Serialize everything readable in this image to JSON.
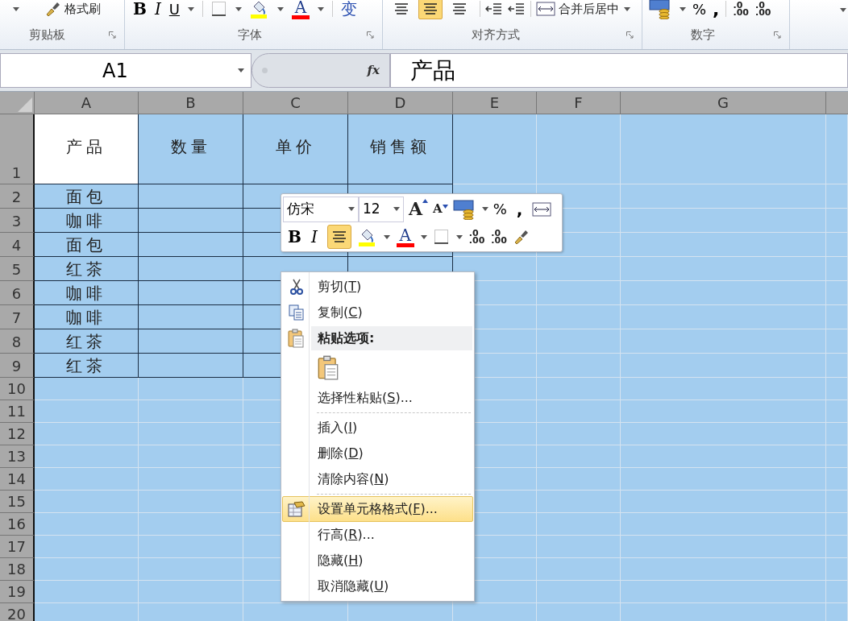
{
  "ribbon": {
    "clipboard": {
      "label": "剪贴板",
      "format_painter": "格式刷"
    },
    "font": {
      "label": "字体",
      "bold": "B",
      "italic": "I",
      "underline": "U",
      "font_color": "A",
      "phonetic": "变"
    },
    "alignment": {
      "label": "对齐方式",
      "align_buttons": [
        {
          "selected": false
        },
        {
          "selected": true
        },
        {
          "selected": false
        }
      ],
      "merge": "合并后居中"
    },
    "number": {
      "label": "数字",
      "percent": "%",
      "comma": ",",
      "decimal_buttons": [
        {
          "top": ".0",
          "bottom": ".00"
        },
        {
          "top": ".0",
          "bottom": ".00"
        }
      ]
    }
  },
  "formula_bar": {
    "name_box": "A1",
    "fx": "fx",
    "formula": "产品"
  },
  "sheet": {
    "columns": [
      "A",
      "B",
      "C",
      "D",
      "E",
      "F",
      "G"
    ],
    "rows": [
      {
        "header": "1",
        "cells": [
          {
            "text": "产品",
            "active": true
          },
          {
            "text": "数量",
            "active": false
          },
          {
            "text": "单价",
            "active": false
          },
          {
            "text": "销售额",
            "active": false
          }
        ]
      },
      {
        "header": "2",
        "cells": [
          {
            "text": "面包",
            "active": false
          }
        ]
      },
      {
        "header": "3",
        "cells": [
          {
            "text": "咖啡",
            "active": false
          }
        ]
      },
      {
        "header": "4",
        "cells": [
          {
            "text": "面包",
            "active": false
          }
        ]
      },
      {
        "header": "5",
        "cells": [
          {
            "text": "红茶",
            "active": false
          }
        ]
      },
      {
        "header": "6",
        "cells": [
          {
            "text": "咖啡",
            "active": false
          }
        ]
      },
      {
        "header": "7",
        "cells": [
          {
            "text": "咖啡",
            "active": false
          }
        ]
      },
      {
        "header": "8",
        "cells": [
          {
            "text": "红茶",
            "active": false
          }
        ]
      },
      {
        "header": "9",
        "cells": [
          {
            "text": "红茶",
            "active": false
          }
        ]
      },
      {
        "header": "10"
      },
      {
        "header": "11"
      },
      {
        "header": "12"
      },
      {
        "header": "13"
      },
      {
        "header": "14"
      },
      {
        "header": "15"
      },
      {
        "header": "16"
      },
      {
        "header": "17"
      },
      {
        "header": "18"
      },
      {
        "header": "19"
      },
      {
        "header": "20"
      }
    ]
  },
  "mini_toolbar": {
    "font": "仿宋",
    "size": "12",
    "grow": "A",
    "shrink": "A",
    "percent": "%",
    "comma": ",",
    "bold": "B",
    "italic": "I",
    "center_align": {
      "selected": true
    },
    "font_color": "A",
    "decimal_buttons": [
      {
        "top": ".0",
        "bottom": ".00"
      },
      {
        "top": ".0",
        "bottom": ".00"
      }
    ]
  },
  "context_menu": [
    {
      "kind": "cut",
      "before": "剪切(",
      "key": "T",
      "after": ")",
      "selected": false
    },
    {
      "kind": "copy",
      "before": "复制(",
      "key": "C",
      "after": ")",
      "selected": false
    },
    {
      "kind": "header",
      "before": "粘贴选项:"
    },
    {
      "kind": "paste"
    },
    {
      "kind": "item",
      "before": "选择性粘贴(",
      "key": "S",
      "after": ")...",
      "selected": false
    },
    {
      "kind": "separator"
    },
    {
      "kind": "item",
      "before": "插入(",
      "key": "I",
      "after": ")",
      "selected": false
    },
    {
      "kind": "item",
      "before": "删除(",
      "key": "D",
      "after": ")",
      "selected": false
    },
    {
      "kind": "item",
      "before": "清除内容(",
      "key": "N",
      "after": ")",
      "selected": false
    },
    {
      "kind": "separator"
    },
    {
      "kind": "format",
      "before": "设置单元格格式(",
      "key": "F",
      "after": ")...",
      "selected": true
    },
    {
      "kind": "item",
      "before": "行高(",
      "key": "R",
      "after": ")...",
      "selected": false
    },
    {
      "kind": "item",
      "before": "隐藏(",
      "key": "H",
      "after": ")",
      "selected": false
    },
    {
      "kind": "item",
      "before": "取消隐藏(",
      "key": "U",
      "after": ")",
      "selected": false
    }
  ]
}
